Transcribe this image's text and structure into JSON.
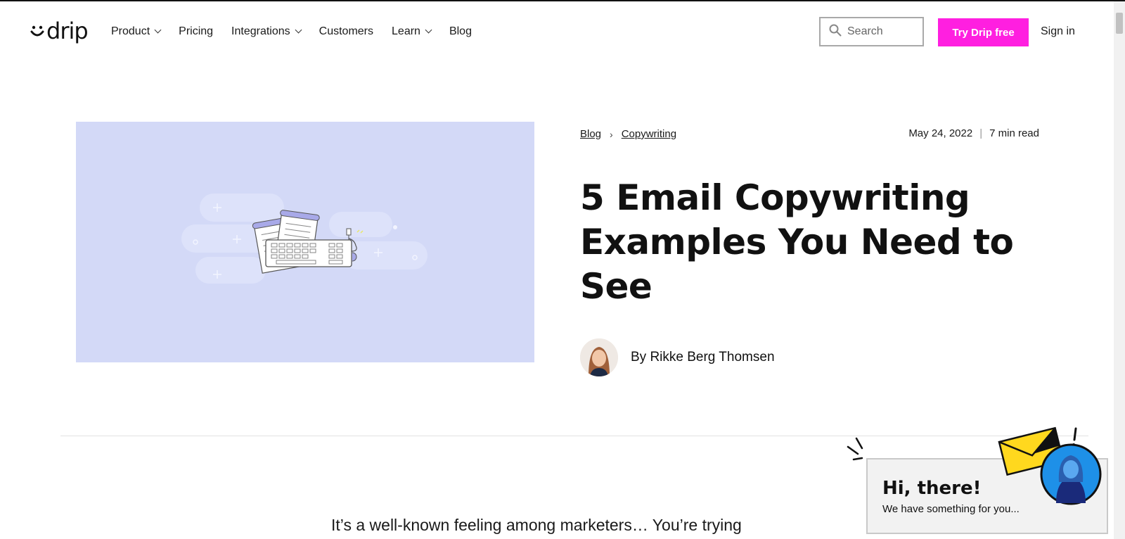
{
  "nav": {
    "logo_text": "drip",
    "items": [
      {
        "label": "Product",
        "has_dropdown": true
      },
      {
        "label": "Pricing",
        "has_dropdown": false
      },
      {
        "label": "Integrations",
        "has_dropdown": true
      },
      {
        "label": "Customers",
        "has_dropdown": false
      },
      {
        "label": "Learn",
        "has_dropdown": true
      },
      {
        "label": "Blog",
        "has_dropdown": false
      }
    ],
    "search_placeholder": "Search",
    "cta_label": "Try Drip free",
    "signin_label": "Sign in"
  },
  "colors": {
    "accent": "#ff1fe0",
    "hero_bg": "#d3d9f7"
  },
  "article": {
    "breadcrumb": [
      "Blog",
      "Copywriting"
    ],
    "date": "May 24, 2022",
    "read_time": "7 min read",
    "title": "5 Email Copywriting Examples You Need to See",
    "author": "By Rikke Berg Thomsen",
    "intro": "It’s a well-known feeling among marketers… You’re trying"
  },
  "popup": {
    "title": "Hi, there!",
    "subtitle": "We have something for you..."
  }
}
